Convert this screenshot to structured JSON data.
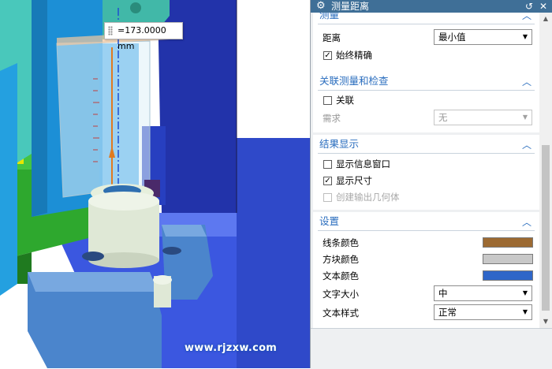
{
  "viewport": {
    "dimension_text": "=173.0000 mm",
    "watermark": "www.rjzxw.com"
  },
  "dialog": {
    "title": "测量距离",
    "sections": {
      "measure": {
        "title": "测量",
        "distance_label": "距离",
        "distance_value": "最小值",
        "always_precise_label": "始终精确",
        "always_precise_checked": true
      },
      "associate": {
        "title": "关联测量和检查",
        "associate_label": "关联",
        "associate_checked": false,
        "requirement_label": "需求",
        "requirement_value": "无"
      },
      "result": {
        "title": "结果显示",
        "show_info_label": "显示信息窗口",
        "show_info_checked": false,
        "show_dimension_label": "显示尺寸",
        "show_dimension_checked": true,
        "create_output_label": "创建输出几何体",
        "create_output_checked": false
      },
      "settings": {
        "title": "设置",
        "line_color_label": "线条颜色",
        "line_color": "#9c6a32",
        "block_color_label": "方块颜色",
        "block_color": "#c8c8c8",
        "text_color_label": "文本颜色",
        "text_color": "#2f66c8",
        "text_size_label": "文字大小",
        "text_size_value": "中",
        "text_style_label": "文本样式",
        "text_style_value": "正常"
      }
    }
  },
  "icons": {
    "gear": "gear-icon",
    "reset": "reset-icon",
    "close": "close-icon",
    "collapse": "chevron-up-icon",
    "dropdown": "dropdown-arrow-icon"
  }
}
